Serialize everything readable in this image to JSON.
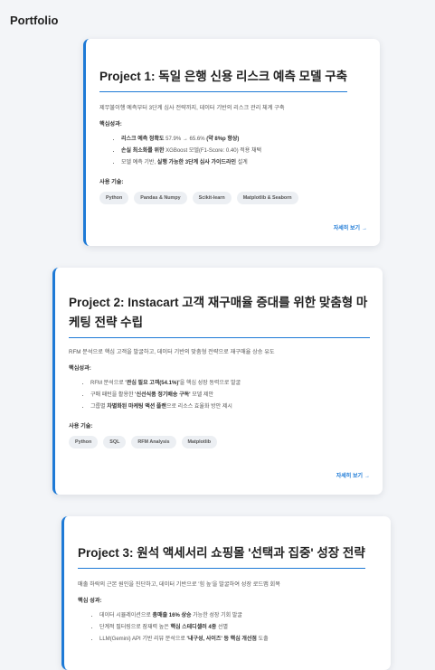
{
  "page": {
    "title": "Portfolio"
  },
  "projects": [
    {
      "title": "Project 1: 독일 은행 신용 리스크 예측 모델 구축",
      "description": "제무불이행 예측부터 3단계 심사 전략까지, 데이터 기반의 리스크 관리 체계 구축",
      "results_label": "핵심성과:",
      "results": [
        [
          {
            "t": "리스크 예측 정확도 ",
            "b": true
          },
          {
            "t": "57.9% → 65.6% ",
            "b": false
          },
          {
            "t": "(약 8%p 향상)",
            "b": true
          }
        ],
        [
          {
            "t": "손실 최소화를 위한 ",
            "b": true
          },
          {
            "t": "XGBoost 모델(F1-Score: 0.40) 적용 채택",
            "b": false
          }
        ],
        [
          {
            "t": "모델 예측 기반, ",
            "b": false
          },
          {
            "t": "실행 가능한 3단계 심사 가이드라인 ",
            "b": true
          },
          {
            "t": "설계",
            "b": false
          }
        ]
      ],
      "tech_label": "사용 기술:",
      "tech": [
        "Python",
        "Pandas & Numpy",
        "Scikit-learn",
        "Matplotlib & Seaborn"
      ],
      "more": "자세히 보기",
      "arrow": "→"
    },
    {
      "title": "Project 2: Instacart 고객 재구매율 증대를 위한 맞춤형 마케팅 전략 수립",
      "description": "RFM 분석으로 핵심 고객을 발굴하고, 데이터 기반의 맞춤형 전략으로 재구매율 상승 유도",
      "results_label": "핵심성과:",
      "results": [
        [
          {
            "t": "RFM 분석으로 ",
            "b": false
          },
          {
            "t": "'관심 필요 고객(54.1%)'",
            "b": true
          },
          {
            "t": "을 핵심 성장 동력으로 발굴",
            "b": false
          }
        ],
        [
          {
            "t": "구매 패턴을 활용한 ",
            "b": false
          },
          {
            "t": "'신선식품 정기배송 구독'",
            "b": true
          },
          {
            "t": " 모델 제안",
            "b": false
          }
        ],
        [
          {
            "t": "그룹별 ",
            "b": false
          },
          {
            "t": "차별화된 마케팅 액션 플랜",
            "b": true
          },
          {
            "t": "으로 리소스 효율화 방안 제시",
            "b": false
          }
        ]
      ],
      "tech_label": "사용 기술:",
      "tech": [
        "Python",
        "SQL",
        "RFM Analysis",
        "Matplotlib"
      ],
      "more": "자세히 보기",
      "arrow": "→"
    },
    {
      "title": "Project 3: 원석 액세서리 쇼핑몰 '선택과 집중' 성장 전략",
      "description": "매출 하락의 근본 원인을 진단하고, 데이터 기반으로 '힘 높'을 발굴하여 성장 로드맵 회복",
      "results_label": "핵심 성과:",
      "results": [
        [
          {
            "t": "데이터 시뮬레이션으로 ",
            "b": false
          },
          {
            "t": "총매출 16% 상승",
            "b": true
          },
          {
            "t": " 가능한 성장 기회 발굴",
            "b": false
          }
        ],
        [
          {
            "t": "단계적 필터링으로 잠재력 높은 ",
            "b": false
          },
          {
            "t": "핵심 스테디셀러 4종",
            "b": true
          },
          {
            "t": " 선별",
            "b": false
          }
        ],
        [
          {
            "t": "LLM(Gemini) API 기반 리뷰 분석으로 ",
            "b": false
          },
          {
            "t": "'내구성, 사이즈' 등 핵심 개선점",
            "b": true
          },
          {
            "t": " 도출",
            "b": false
          }
        ]
      ]
    }
  ]
}
